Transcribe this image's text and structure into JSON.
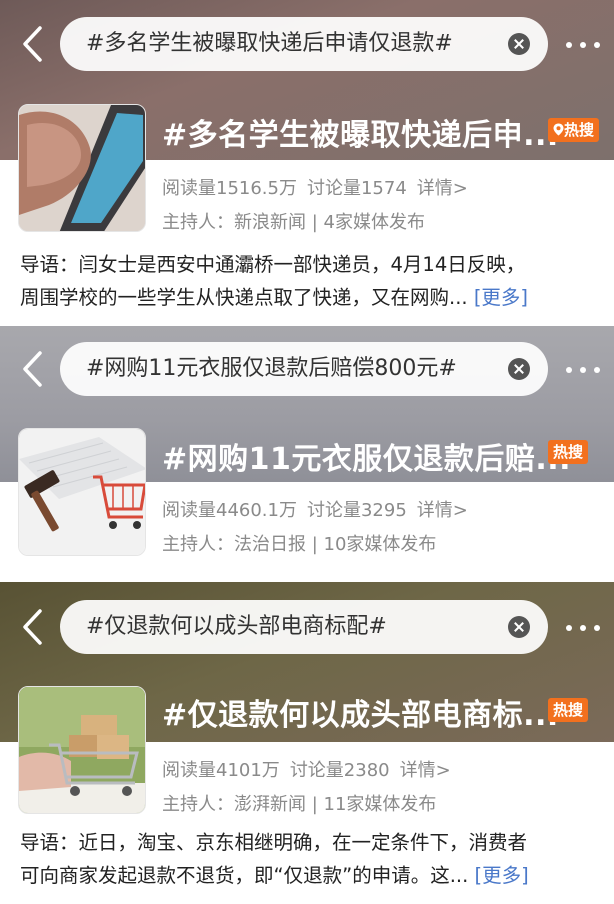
{
  "panels": [
    {
      "search_query": "#多名学生被曝取快递后申请仅退款#",
      "title": "#多名学生被曝取快递后申...",
      "badge": "热搜",
      "read_count": "阅读量1516.5万",
      "discuss_count": "讨论量1574",
      "detail_link": "详情>",
      "host": "主持人：新浪新闻 | 4家媒体发布",
      "intro_line1": "导语：闫女士是西安中通灞桥一部快递员，4月14日反映，",
      "intro_line2": "周围学校的一些学生从快递点取了快递，又在网购...",
      "more_link": "[更多]"
    },
    {
      "search_query": "#网购11元衣服仅退款后赔偿800元#",
      "title": "#网购11元衣服仅退款后赔...",
      "badge": "热搜",
      "read_count": "阅读量4460.1万",
      "discuss_count": "讨论量3295",
      "detail_link": "详情>",
      "host": "主持人：法治日报 | 10家媒体发布"
    },
    {
      "search_query": "#仅退款何以成头部电商标配#",
      "title": "#仅退款何以成头部电商标...",
      "badge": "热搜",
      "read_count": "阅读量4101万",
      "discuss_count": "讨论量2380",
      "detail_link": "详情>",
      "host": "主持人：澎湃新闻 | 11家媒体发布",
      "intro_line1": "导语：近日，淘宝、京东相继明确，在一定条件下，消费者",
      "intro_line2": "可向商家发起退款不退货，即“仅退款”的申请。这...",
      "more_link": "[更多]"
    }
  ],
  "icons": {
    "back": "chevron-left-icon",
    "clear": "clear-icon",
    "more": "more-dots-icon",
    "location": "location-pin-icon"
  },
  "colors": {
    "badge": "#f2701e",
    "link": "#4a78c9",
    "meta_text": "#8a8a8a"
  }
}
